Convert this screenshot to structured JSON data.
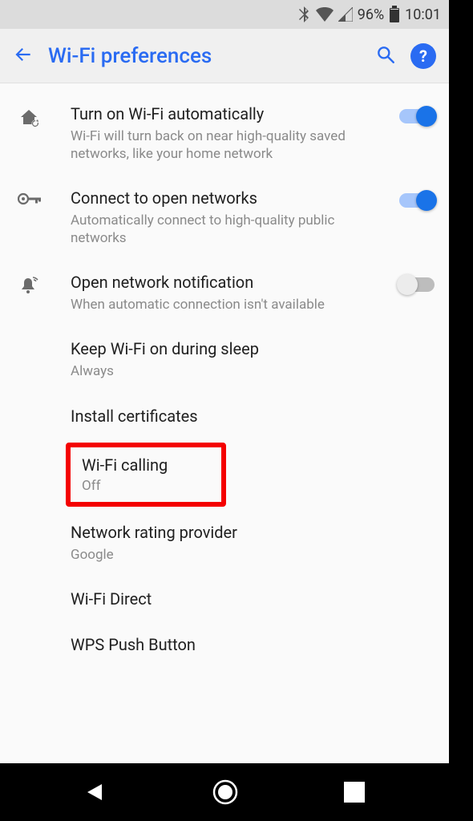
{
  "statusbar": {
    "battery_percent": "96%",
    "time": "10:01"
  },
  "appbar": {
    "title": "Wi-Fi preferences"
  },
  "settings": {
    "auto_wifi": {
      "title": "Turn on Wi-Fi automatically",
      "subtitle": "Wi-Fi will turn back on near high-quality saved networks, like your home network"
    },
    "open_networks": {
      "title": "Connect to open networks",
      "subtitle": "Automatically connect to high-quality public networks"
    },
    "open_notification": {
      "title": "Open network notification",
      "subtitle": "When automatic connection isn't available"
    },
    "keep_on_sleep": {
      "title": "Keep Wi-Fi on during sleep",
      "subtitle": "Always"
    },
    "install_certs": {
      "title": "Install certificates"
    },
    "wifi_calling": {
      "title": "Wi-Fi calling",
      "subtitle": "Off"
    },
    "rating_provider": {
      "title": "Network rating provider",
      "subtitle": "Google"
    },
    "wifi_direct": {
      "title": "Wi-Fi Direct"
    },
    "wps_push": {
      "title": "WPS Push Button"
    }
  }
}
